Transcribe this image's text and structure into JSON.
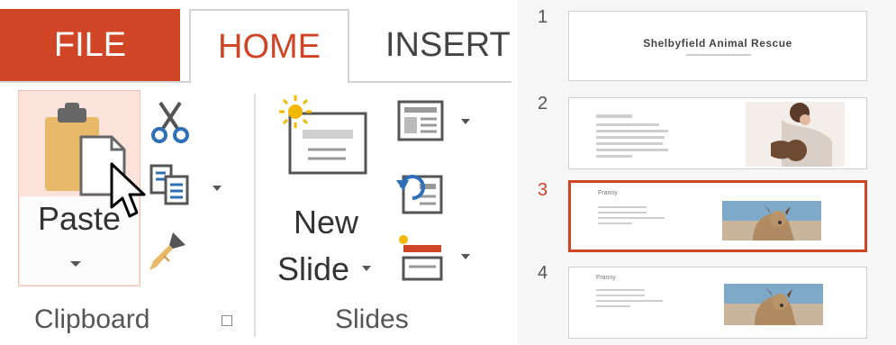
{
  "ribbon": {
    "tabs": [
      {
        "label": "FILE"
      },
      {
        "label": "HOME"
      },
      {
        "label": "INSERT"
      }
    ],
    "clipboard": {
      "paste_label": "Paste",
      "group_label": "Clipboard"
    },
    "slides": {
      "new_slide_line1": "New",
      "new_slide_line2": "Slide",
      "group_label": "Slides"
    }
  },
  "thumbnails": [
    {
      "number": "1",
      "title": "Shelbyfield Animal Rescue"
    },
    {
      "number": "2"
    },
    {
      "number": "3",
      "heading": "Franny",
      "active": true
    },
    {
      "number": "4",
      "heading": "Franny"
    }
  ],
  "colors": {
    "accent": "#d04525",
    "paste_hover": "#fbe3dc"
  }
}
